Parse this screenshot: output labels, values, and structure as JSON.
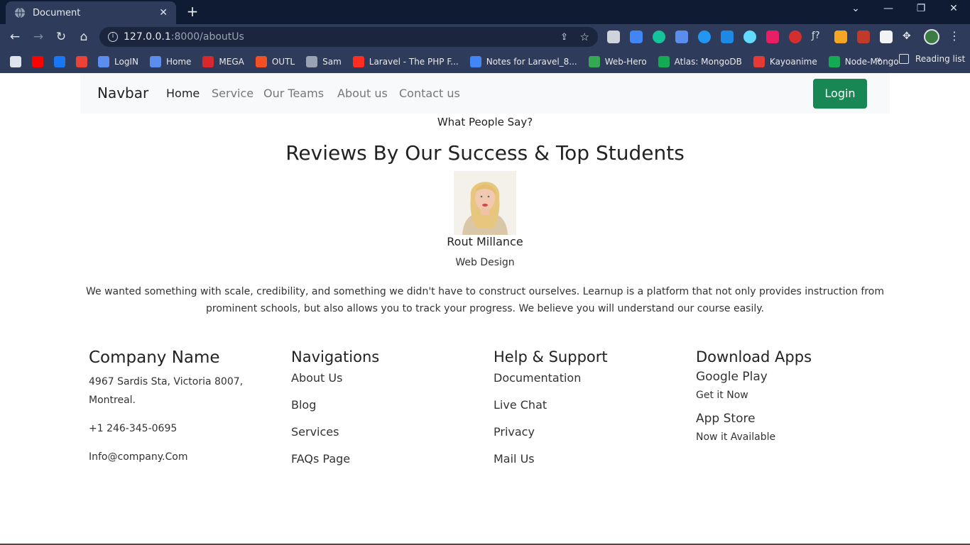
{
  "browser": {
    "tab_title": "Document",
    "tab_close": "✕",
    "new_tab": "+",
    "url_host": "127.0.0.1",
    "url_path": ":8000/aboutUs",
    "bookmarks": [
      {
        "label": "",
        "color": "#dfe3ea"
      },
      {
        "label": "",
        "color": "#ff0000"
      },
      {
        "label": "",
        "color": "#1877f2"
      },
      {
        "label": "",
        "color": "#ea4335"
      },
      {
        "label": "LogIN",
        "color": "#5b8def"
      },
      {
        "label": "Home",
        "color": "#5b8def"
      },
      {
        "label": "MEGA",
        "color": "#d9272e"
      },
      {
        "label": "OUTL",
        "color": "#f25022"
      },
      {
        "label": "Sam",
        "color": "#9aa3b5"
      },
      {
        "label": "Laravel - The PHP F...",
        "color": "#ff2d20"
      },
      {
        "label": "Notes for Laravel_8...",
        "color": "#4285f4"
      },
      {
        "label": "Web-Hero",
        "color": "#34a853"
      },
      {
        "label": "Atlas: MongoDB",
        "color": "#13aa52"
      },
      {
        "label": "Kayoanime",
        "color": "#e53935"
      },
      {
        "label": "Node-Mongo",
        "color": "#13aa52"
      }
    ],
    "bookmarks_more": "»",
    "reading_list": "Reading list"
  },
  "navbar": {
    "brand": "Navbar",
    "links": [
      "Home",
      "Service",
      "Our Teams",
      "About us",
      "Contact us"
    ],
    "login": "Login"
  },
  "testimonial": {
    "kicker": "What People Say?",
    "headline": "Reviews By Our Success & Top Students",
    "name": "Rout Millance",
    "role": "Web Design",
    "quote": "We wanted something with scale, credibility, and something we didn't have to construct ourselves. Learnup is a platform that not only provides instruction from prominent schools, but also allows you to track your progress. We believe you will understand our course easily."
  },
  "footer": {
    "company": {
      "heading": "Company Name",
      "address": "4967 Sardis Sta, Victoria 8007, Montreal.",
      "phone": "+1 246-345-0695",
      "email": "Info@company.Com"
    },
    "navigations": {
      "heading": "Navigations",
      "links": [
        "About Us",
        "Blog",
        "Services",
        "FAQs Page"
      ]
    },
    "support": {
      "heading": "Help & Support",
      "links": [
        "Documentation",
        "Live Chat",
        "Privacy",
        "Mail Us"
      ]
    },
    "apps": {
      "heading": "Download Apps",
      "google_title": "Google Play",
      "google_sub": "Get it Now",
      "appstore_title": "App Store",
      "appstore_sub": "Now it Available"
    }
  }
}
